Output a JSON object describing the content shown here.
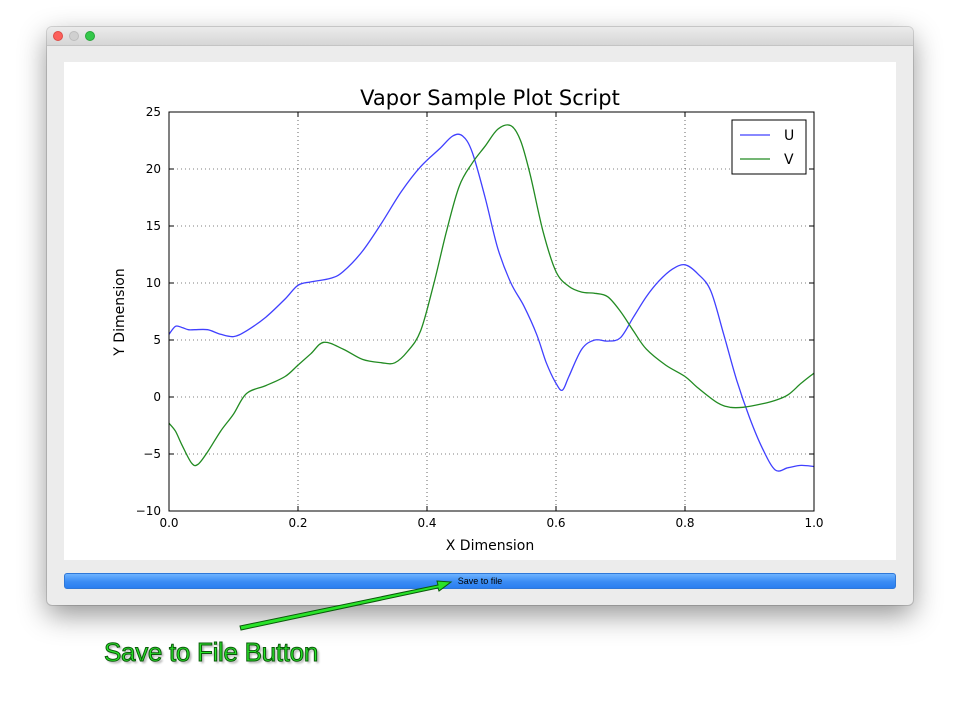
{
  "window": {
    "traffic_lights": [
      "close",
      "minimize",
      "zoom"
    ]
  },
  "plot": {
    "title": "Vapor Sample Plot Script",
    "save_button_label": "Save to file"
  },
  "annotation": {
    "label": "Save to File Button",
    "color": "#29e329"
  },
  "chart_data": {
    "type": "line",
    "title": "Vapor Sample Plot Script",
    "xlabel": "X Dimension",
    "ylabel": "Y Dimension",
    "xlim": [
      0.0,
      1.0
    ],
    "ylim": [
      -10,
      25
    ],
    "xticks": [
      "0.0",
      "0.2",
      "0.4",
      "0.6",
      "0.8",
      "1.0"
    ],
    "yticks": [
      "−10",
      "−5",
      "0",
      "5",
      "10",
      "15",
      "20",
      "25"
    ],
    "grid": true,
    "legend_position": "top-right",
    "series": [
      {
        "name": "U",
        "color": "#4040ff",
        "x": [
          0.0,
          0.01,
          0.02,
          0.03,
          0.04,
          0.06,
          0.08,
          0.1,
          0.12,
          0.15,
          0.18,
          0.2,
          0.22,
          0.25,
          0.27,
          0.3,
          0.33,
          0.36,
          0.39,
          0.42,
          0.44,
          0.455,
          0.47,
          0.49,
          0.51,
          0.53,
          0.55,
          0.57,
          0.585,
          0.6,
          0.61,
          0.62,
          0.64,
          0.66,
          0.68,
          0.7,
          0.72,
          0.74,
          0.76,
          0.78,
          0.8,
          0.82,
          0.84,
          0.86,
          0.88,
          0.9,
          0.92,
          0.94,
          0.96,
          0.98,
          1.0
        ],
        "y": [
          5.5,
          6.2,
          6.1,
          5.9,
          5.9,
          5.9,
          5.5,
          5.3,
          5.8,
          7.0,
          8.6,
          9.8,
          10.1,
          10.4,
          11.0,
          12.8,
          15.3,
          18.0,
          20.2,
          21.8,
          22.9,
          22.9,
          21.5,
          17.5,
          13.0,
          10.0,
          8.0,
          5.5,
          3.0,
          1.2,
          0.6,
          1.8,
          4.2,
          5.0,
          4.9,
          5.2,
          7.0,
          8.8,
          10.2,
          11.2,
          11.6,
          10.8,
          9.3,
          5.5,
          1.5,
          -1.8,
          -4.5,
          -6.4,
          -6.2,
          -6.0,
          -6.1
        ]
      },
      {
        "name": "V",
        "color": "#228b22",
        "x": [
          0.0,
          0.01,
          0.02,
          0.035,
          0.045,
          0.06,
          0.08,
          0.1,
          0.12,
          0.15,
          0.18,
          0.2,
          0.22,
          0.24,
          0.27,
          0.3,
          0.33,
          0.35,
          0.37,
          0.39,
          0.41,
          0.43,
          0.45,
          0.47,
          0.49,
          0.51,
          0.53,
          0.545,
          0.56,
          0.58,
          0.6,
          0.62,
          0.64,
          0.66,
          0.68,
          0.7,
          0.72,
          0.74,
          0.77,
          0.8,
          0.82,
          0.85,
          0.87,
          0.89,
          0.92,
          0.94,
          0.96,
          0.98,
          1.0
        ],
        "y": [
          -2.3,
          -3.0,
          -4.2,
          -5.8,
          -5.9,
          -4.8,
          -3.0,
          -1.5,
          0.3,
          1.0,
          1.8,
          2.8,
          3.8,
          4.8,
          4.2,
          3.3,
          3.0,
          3.0,
          4.0,
          5.8,
          9.8,
          14.5,
          18.5,
          20.5,
          22.0,
          23.5,
          23.8,
          22.5,
          19.5,
          14.5,
          11.0,
          9.7,
          9.2,
          9.1,
          8.8,
          7.5,
          5.8,
          4.2,
          2.8,
          1.8,
          0.8,
          -0.5,
          -0.9,
          -0.9,
          -0.6,
          -0.3,
          0.2,
          1.2,
          2.1
        ]
      }
    ]
  }
}
